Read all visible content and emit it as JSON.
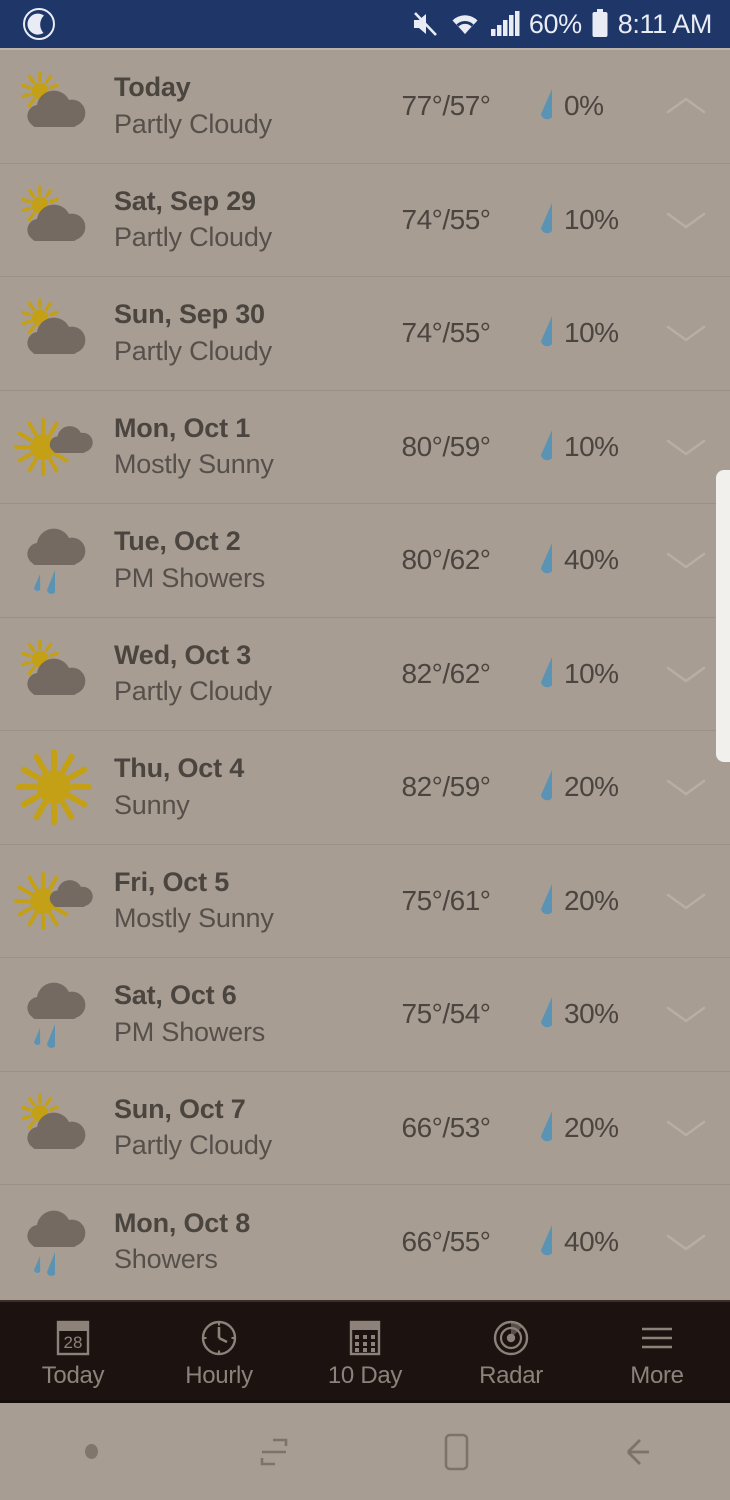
{
  "status_bar": {
    "background": "#1e3668",
    "left_icon": "moon-icon",
    "mute_icon": "mute-icon",
    "wifi_icon": "wifi-icon",
    "signal_icon": "signal-bars-icon",
    "battery_percent": "60%",
    "battery_icon": "battery-icon",
    "time": "8:11 AM"
  },
  "theme": {
    "page_background": "#a89d93",
    "row_divider": "#9c9188",
    "text_primary": "#4b4540",
    "text_secondary": "#56504b",
    "rain_blue": "#5b93b5",
    "sun_yellow": "#c4a017",
    "cloud_gray": "#746a62",
    "tabbar_background": "#1c1311",
    "tabbar_text": "#8d8279",
    "scrollbar": "#f2f0ec"
  },
  "forecast": {
    "rows": [
      {
        "day": "Today",
        "condition": "Partly Cloudy",
        "temps": "77°/57°",
        "high": "77°",
        "low": "57°",
        "precip": "0%",
        "icon": "partly-cloudy-icon",
        "chevron": "chevron-up-icon",
        "expanded": true
      },
      {
        "day": "Sat, Sep 29",
        "condition": "Partly Cloudy",
        "temps": "74°/55°",
        "high": "74°",
        "low": "55°",
        "precip": "10%",
        "icon": "partly-cloudy-icon",
        "chevron": "chevron-down-icon",
        "expanded": false
      },
      {
        "day": "Sun, Sep 30",
        "condition": "Partly Cloudy",
        "temps": "74°/55°",
        "high": "74°",
        "low": "55°",
        "precip": "10%",
        "icon": "partly-cloudy-icon",
        "chevron": "chevron-down-icon",
        "expanded": false
      },
      {
        "day": "Mon, Oct 1",
        "condition": "Mostly Sunny",
        "temps": "80°/59°",
        "high": "80°",
        "low": "59°",
        "precip": "10%",
        "icon": "mostly-sunny-icon",
        "chevron": "chevron-down-icon",
        "expanded": false
      },
      {
        "day": "Tue, Oct 2",
        "condition": "PM Showers",
        "temps": "80°/62°",
        "high": "80°",
        "low": "62°",
        "precip": "40%",
        "icon": "showers-icon",
        "chevron": "chevron-down-icon",
        "expanded": false
      },
      {
        "day": "Wed, Oct 3",
        "condition": "Partly Cloudy",
        "temps": "82°/62°",
        "high": "82°",
        "low": "62°",
        "precip": "10%",
        "icon": "partly-cloudy-icon",
        "chevron": "chevron-down-icon",
        "expanded": false
      },
      {
        "day": "Thu, Oct 4",
        "condition": "Sunny",
        "temps": "82°/59°",
        "high": "82°",
        "low": "59°",
        "precip": "20%",
        "icon": "sunny-icon",
        "chevron": "chevron-down-icon",
        "expanded": false
      },
      {
        "day": "Fri, Oct 5",
        "condition": "Mostly Sunny",
        "temps": "75°/61°",
        "high": "75°",
        "low": "61°",
        "precip": "20%",
        "icon": "mostly-sunny-icon",
        "chevron": "chevron-down-icon",
        "expanded": false
      },
      {
        "day": "Sat, Oct 6",
        "condition": "PM Showers",
        "temps": "75°/54°",
        "high": "75°",
        "low": "54°",
        "precip": "30%",
        "icon": "showers-icon",
        "chevron": "chevron-down-icon",
        "expanded": false
      },
      {
        "day": "Sun, Oct 7",
        "condition": "Partly Cloudy",
        "temps": "66°/53°",
        "high": "66°",
        "low": "53°",
        "precip": "20%",
        "icon": "partly-cloudy-icon",
        "chevron": "chevron-down-icon",
        "expanded": false
      },
      {
        "day": "Mon, Oct 8",
        "condition": "Showers",
        "temps": "66°/55°",
        "high": "66°",
        "low": "55°",
        "precip": "40%",
        "icon": "showers-icon",
        "chevron": "chevron-down-icon",
        "expanded": false
      }
    ]
  },
  "tab_bar": {
    "tabs": [
      {
        "label": "Today",
        "icon": "calendar-today-icon",
        "badge": "28"
      },
      {
        "label": "Hourly",
        "icon": "clock-icon"
      },
      {
        "label": "10 Day",
        "icon": "calendar-grid-icon"
      },
      {
        "label": "Radar",
        "icon": "radar-icon"
      },
      {
        "label": "More",
        "icon": "hamburger-menu-icon"
      }
    ]
  },
  "nav_bar": {
    "items": [
      {
        "icon": "nav-dot-icon"
      },
      {
        "icon": "recents-icon"
      },
      {
        "icon": "home-icon"
      },
      {
        "icon": "back-icon"
      }
    ]
  }
}
